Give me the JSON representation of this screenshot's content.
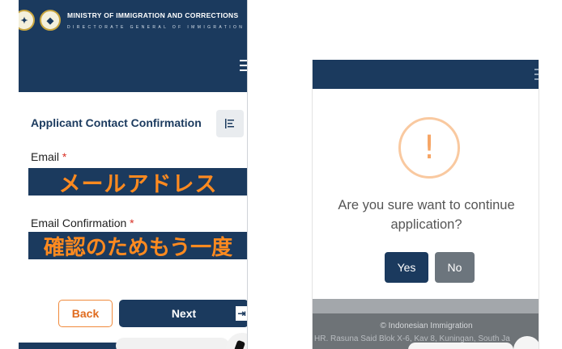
{
  "left_panel": {
    "header": {
      "ministry": "MINISTRY OF IMMIGRATION AND CORRECTIONS",
      "directorate": "DIRECTORATE GENERAL OF IMMIGRATION"
    },
    "section_title": "Applicant Contact Confirmation",
    "email": {
      "label": "Email",
      "required_mark": "*",
      "overlay_text": "メールアドレス"
    },
    "email_confirmation": {
      "label": "Email Confirmation",
      "required_mark": "*",
      "overlay_text": "確認のためもう一度"
    },
    "buttons": {
      "back": "Back",
      "next": "Next",
      "next_arrow": "⇥"
    }
  },
  "right_panel": {
    "dialog": {
      "icon": "!",
      "message": "Are you sure want to continue application?",
      "yes": "Yes",
      "no": "No"
    },
    "footer": {
      "copyright": "© Indonesian Immigration",
      "address": "HR. Rasuna Said Blok X-6, Kav 8, Kuningan, South Ja"
    }
  },
  "colors": {
    "navy": "#1b3a5e",
    "orange": "#ff8a1f",
    "warning": "#f6a565",
    "gray_button": "#6c757d"
  }
}
